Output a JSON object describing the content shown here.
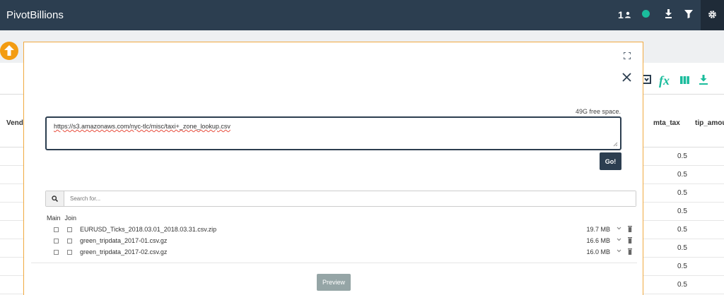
{
  "app": {
    "title": "PivotBillions"
  },
  "topbar": {
    "user_count": "1"
  },
  "background": {
    "columns": {
      "vendor": "Vend",
      "mta_tax": "mta_tax",
      "tip": "tip_amount"
    },
    "mta_values": [
      "0.5",
      "0.5",
      "0.5",
      "0.5",
      "0.5",
      "0.5",
      "0.5",
      "0.5"
    ]
  },
  "modal": {
    "free_space": "49G free space.",
    "url_value": "https://s3.amazonaws.com/nyc-tlc/misc/taxi+_zone_lookup.csv",
    "go_label": "Go!",
    "search_placeholder": "Search for...",
    "list_headers": {
      "main": "Main",
      "join": "Join"
    },
    "files": [
      {
        "name": "EURUSD_Ticks_2018.03.01_2018.03.31.csv.zip",
        "size": "19.7 MB"
      },
      {
        "name": "green_tripdata_2017-01.csv.gz",
        "size": "16.6 MB"
      },
      {
        "name": "green_tripdata_2017-02.csv.gz",
        "size": "16.0 MB"
      }
    ],
    "preview_label": "Preview"
  },
  "colors": {
    "navbar": "#2c3e50",
    "accent": "#1abc9c",
    "orange": "#f39c12",
    "preview_button": "#95a5a6"
  }
}
